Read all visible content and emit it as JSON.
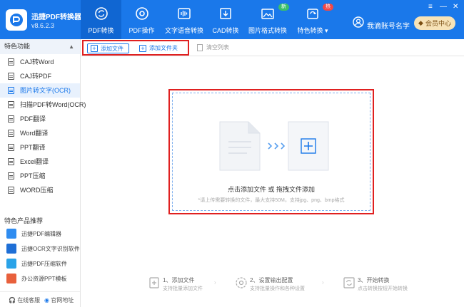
{
  "app": {
    "name": "迅捷PDF转换器",
    "version": "v8.6.2.3"
  },
  "nav": [
    {
      "label": "PDF转换",
      "icon": "refresh-icon",
      "active": true
    },
    {
      "label": "PDF操作",
      "icon": "gear-icon"
    },
    {
      "label": "文字语音转换",
      "icon": "audio-wave-icon"
    },
    {
      "label": "CAD转换",
      "icon": "cad-icon"
    },
    {
      "label": "图片格式转换",
      "icon": "image-icon",
      "badge": "新"
    },
    {
      "label": "特色转换 ▾",
      "icon": "feature-icon",
      "badge": "热"
    }
  ],
  "user": {
    "name": "我滴账号名字",
    "vip_label": "会员中心"
  },
  "sidebar": {
    "section_title": "特色功能",
    "items": [
      {
        "label": "CAJ转Word"
      },
      {
        "label": "CAJ转PDF"
      },
      {
        "label": "图片转文字(OCR)",
        "active": true
      },
      {
        "label": "扫描PDF转Word(OCR)"
      },
      {
        "label": "PDF翻译"
      },
      {
        "label": "Word翻译"
      },
      {
        "label": "PPT翻译"
      },
      {
        "label": "Excel翻译"
      },
      {
        "label": "PPT压缩"
      },
      {
        "label": "WORD压缩"
      }
    ],
    "products_title": "特色产品推荐",
    "products": [
      {
        "label": "迅捷PDF编辑器",
        "color": "#2f8cf0"
      },
      {
        "label": "迅捷OCR文字识别软件",
        "color": "#1f6fd6"
      },
      {
        "label": "迅捷PDF压缩软件",
        "color": "#2aa3e8"
      },
      {
        "label": "办公资源PPT模板",
        "color": "#e8603c"
      }
    ],
    "footer": {
      "online_service": "在线客服",
      "official_site": "官网地址"
    }
  },
  "toolbar": {
    "add_file": "添加文件",
    "add_folder": "添加文件夹",
    "clear_list": "清空列表"
  },
  "dropzone": {
    "title": "点击添加文件 或 拖拽文件添加",
    "subtitle": "*请上传需要转换的文件，最大支持50M，支持jpg、png、bmp格式"
  },
  "steps": [
    {
      "title": "1、添加文件",
      "desc": "支持批量添加文件"
    },
    {
      "title": "2、设置输出配置",
      "desc": "支持批量操作和各种设置"
    },
    {
      "title": "3、开始转换",
      "desc": "点击转换按钮开始转换"
    }
  ],
  "colors": {
    "primary": "#1a78ea",
    "highlight": "#e02020"
  }
}
